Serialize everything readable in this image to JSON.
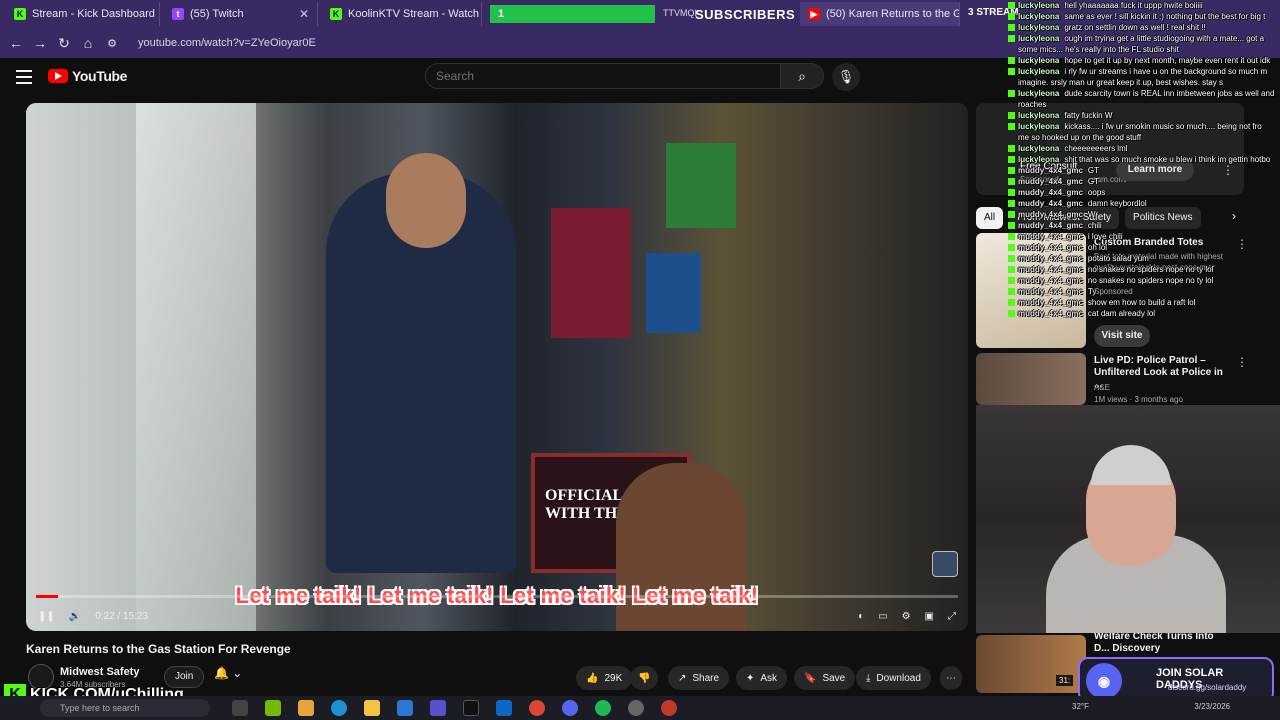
{
  "browser": {
    "tabs": [
      {
        "title": "Stream - Kick Dashboard",
        "favicon": "kick-icon"
      },
      {
        "title": "(55) Twitch",
        "favicon": "twitch-icon"
      },
      {
        "title": "KoolinKTV Stream - Watch Live",
        "favicon": "kick-icon"
      },
      {
        "title": "(50) Karen Returns to the G",
        "favicon": "youtube-icon"
      }
    ],
    "url": "youtube.com/watch?v=ZYeOioyar0E"
  },
  "overlay": {
    "sub_goal_count": "1",
    "sub_goal_label": "SUBSCRIBERS",
    "tab_fragment_left": "TTVMQI",
    "tab_fragment_right": "3 STREAM",
    "kick_url": "KICK.COM/uChilling"
  },
  "youtube": {
    "logo_text": "YouTube",
    "search_placeholder": "Search",
    "video": {
      "subtitle": "Let me taik! Let me taik! Let me taik! Let me taik!",
      "time": "0:22 / 15:23",
      "progress": 0.024,
      "store_sign": "OFFICIAL B... WITH THE FI..."
    },
    "title": "Karen Returns to the Gas Station For Revenge",
    "channel": {
      "name": "Midwest Safety",
      "subs": "3.64M subscribers",
      "join_label": "Join"
    },
    "actions": {
      "likes": "29K",
      "share": "Share",
      "ask": "Ask",
      "save": "Save",
      "download": "Download"
    }
  },
  "sidebar": {
    "ad1": {
      "heading": "Free Consult",
      "domain": "...sam.com/",
      "sponsored": "Sponsored",
      "learn_more": "Learn more"
    },
    "chips": [
      "All",
      "From Midwest Safety",
      "Politics News"
    ],
    "ad2": {
      "title": "Custom Branded Totes",
      "desc": "Best tote material made with highest quality sustainable post-consumer",
      "sponsored": "Sponsored",
      "visit": "Visit site"
    },
    "video2": {
      "title": "Live PD: Police Patrol – Unfiltered Look at Police in ...",
      "channel": "A&E",
      "meta": "1M views · 3 months ago"
    },
    "video3": {
      "title": "Welfare Check Turns Into D... Discovery",
      "duration": "31:"
    }
  },
  "chat": [
    {
      "user": "luckyleona",
      "msg": "hell yhaaaaaaa fuck it uppp hwite boiiiii",
      "kind": "l"
    },
    {
      "user": "luckyleona",
      "msg": "same as ever ! sill kickin it :) nothing but the best for big t",
      "kind": "l"
    },
    {
      "user": "luckyleona",
      "msg": "gratz on settlin down as well ! real shit !!",
      "kind": "l"
    },
    {
      "user": "luckyleona",
      "msg": "ough im tryina get a little studiogoing with a mate... got a",
      "kind": "l"
    },
    {
      "user": "",
      "msg": "some mics... he's really into the FL studio shit",
      "kind": "c"
    },
    {
      "user": "luckyleona",
      "msg": "hope to get it up by next month, maybe even rent it out idk",
      "kind": "l"
    },
    {
      "user": "luckyleona",
      "msg": "i rly fw ur streams i have u on the background so much m",
      "kind": "l"
    },
    {
      "user": "",
      "msg": "imagine. srsly man ur great keep it up, best wishes. stay s",
      "kind": "c"
    },
    {
      "user": "luckyleona",
      "msg": "dude scarcity town is REAL inn imbetween jobs as well and",
      "kind": "l"
    },
    {
      "user": "",
      "msg": "roaches",
      "kind": "c"
    },
    {
      "user": "luckyleona",
      "msg": "fatty fuckin W",
      "kind": "l"
    },
    {
      "user": "luckyleona",
      "msg": "kickass.... i fw ur smokin music so much.... being not fro",
      "kind": "l"
    },
    {
      "user": "",
      "msg": "me so hooked up on the good stuff",
      "kind": "c"
    },
    {
      "user": "luckyleona",
      "msg": "cheeeeeeeers lml",
      "kind": "l"
    },
    {
      "user": "luckyleona",
      "msg": "shit that was so much smoke u blew i think im gettin hotbo",
      "kind": "l"
    },
    {
      "user": "muddy_4x4_gmc",
      "msg": "GT",
      "kind": "m"
    },
    {
      "user": "muddy_4x4_gmc",
      "msg": "GT",
      "kind": "m"
    },
    {
      "user": "muddy_4x4_gmc",
      "msg": "oops",
      "kind": "m"
    },
    {
      "user": "muddy_4x4_gmc",
      "msg": "damn keybordlol",
      "kind": "m"
    },
    {
      "user": "muddy_4x4_gmc",
      "msg": "W",
      "kind": "m"
    },
    {
      "user": "muddy_4x4_gmc",
      "msg": "chili",
      "kind": "m"
    },
    {
      "user": "muddy_4x4_gmc",
      "msg": "i love chili",
      "kind": "m"
    },
    {
      "user": "muddy_4x4_gmc",
      "msg": "oh lol",
      "kind": "m"
    },
    {
      "user": "muddy_4x4_gmc",
      "msg": "potato salad yum",
      "kind": "m"
    },
    {
      "user": "muddy_4x4_gmc",
      "msg": "no snakes no spiders nope no ty lol",
      "kind": "m"
    },
    {
      "user": "muddy_4x4_gmc",
      "msg": "no snakes no spiders nope no ty lol",
      "kind": "m"
    },
    {
      "user": "muddy_4x4_gmc",
      "msg": "Ty",
      "kind": "m"
    },
    {
      "user": "muddy_4x4_gmc",
      "msg": "show em how to build a raft lol",
      "kind": "m"
    },
    {
      "user": "muddy_4x4_gmc",
      "msg": "cat dam already lol",
      "kind": "m"
    }
  ],
  "discord": {
    "title": "JOIN SOLAR DADDYS",
    "link": "discord.gg/solardaddy"
  },
  "taskbar": {
    "search_placeholder": "Type here to search",
    "temp": "32°F",
    "date": "3/23/2026"
  },
  "colors": {
    "accent_red": "#ff0000",
    "kick_green": "#53fc18",
    "browser_purple": "#3a2a63",
    "discord_blurple": "#5865f2"
  }
}
